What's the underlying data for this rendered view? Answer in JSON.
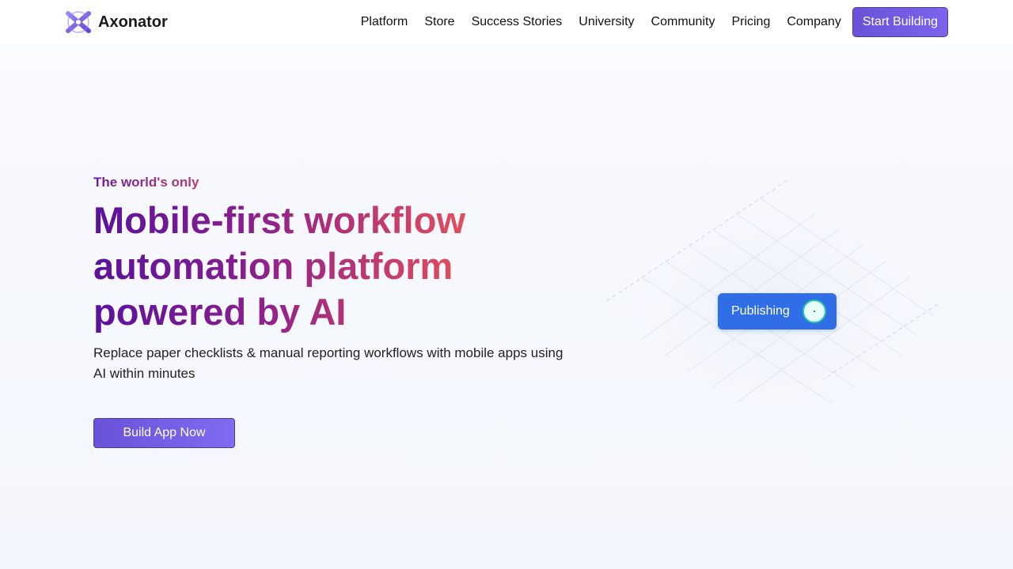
{
  "nav": {
    "brand": "Axonator",
    "logo_icon": "axonator-x-logo-icon",
    "links": [
      "Platform",
      "Store",
      "Success Stories",
      "University",
      "Community",
      "Pricing",
      "Company"
    ],
    "cta": "Start Building"
  },
  "hero": {
    "eyebrow": "The world's only",
    "headline": "Mobile-first workflow automation platform powered by AI",
    "subhead": "Replace paper checklists & manual reporting workflows with mobile apps using AI within minutes",
    "cta": "Build App Now"
  },
  "illustration": {
    "status_label": "Publishing",
    "status_icon": "loading-spinner-icon"
  },
  "colors": {
    "accent": "#6a52d8",
    "publishing_blue": "#2f6ee6",
    "spinner_green": "#22c9a4",
    "headline_start": "#5a129c",
    "headline_end": "#e5505a"
  }
}
